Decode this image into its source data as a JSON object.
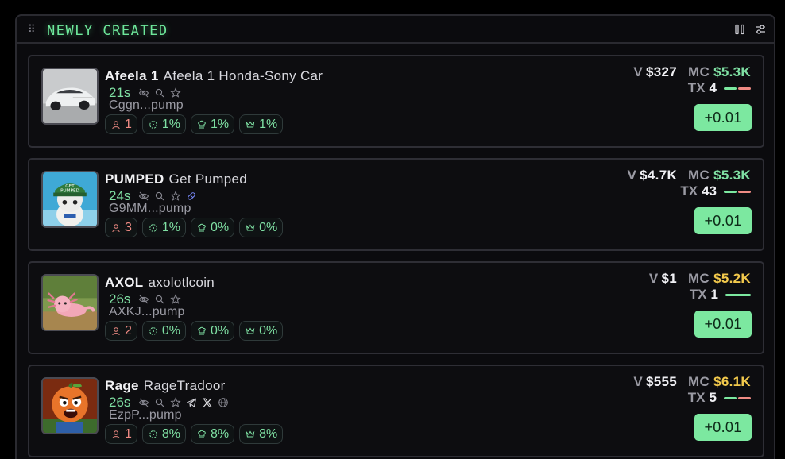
{
  "panel": {
    "title": "NEWLY CREATED",
    "icons": {
      "drag": "drag-handle-icon",
      "pause": "pause-icon",
      "filter": "filter-sliders-icon"
    }
  },
  "labels": {
    "volume": "V",
    "market_cap": "MC",
    "tx": "TX"
  },
  "colors": {
    "accent_green": "#6ee89b",
    "mc_green": "#7fe0a3",
    "mc_yellow": "#f2c94c",
    "holders_red": "#f08b84",
    "buy_button": "#7ce8a0",
    "tx_buy": "#7ce8a0",
    "tx_sell": "#f08b84"
  },
  "tokens": [
    {
      "ticker": "Afeela 1",
      "name": "Afeela 1 Honda-Sony Car",
      "age": "21s",
      "meta_icons": [
        "eye-off-icon",
        "search-icon",
        "star-icon"
      ],
      "address": "Cggn...pump",
      "holders": "1",
      "stat2": "1%",
      "stat3": "1%",
      "stat4": "1%",
      "volume": "$327",
      "market_cap": "$5.3K",
      "mc_color": "green",
      "tx": "4",
      "tx_buy_ratio": 0.5,
      "buy_label": "+0.01",
      "avatar": "car-image"
    },
    {
      "ticker": "PUMPED",
      "name": "Get Pumped",
      "age": "24s",
      "meta_icons": [
        "eye-off-icon",
        "search-icon",
        "star-icon",
        "pumpfun-icon"
      ],
      "address": "G9MM...pump",
      "holders": "3",
      "stat2": "1%",
      "stat3": "0%",
      "stat4": "0%",
      "volume": "$4.7K",
      "market_cap": "$5.3K",
      "mc_color": "green",
      "tx": "43",
      "tx_buy_ratio": 0.5,
      "buy_label": "+0.01",
      "avatar": "cartoon-pumped-image"
    },
    {
      "ticker": "AXOL",
      "name": "axolotlcoin",
      "age": "26s",
      "meta_icons": [
        "eye-off-icon",
        "search-icon",
        "star-icon"
      ],
      "address": "AXKJ...pump",
      "holders": "2",
      "stat2": "0%",
      "stat3": "0%",
      "stat4": "0%",
      "volume": "$1",
      "market_cap": "$5.2K",
      "mc_color": "yellow",
      "tx": "1",
      "tx_buy_ratio": 1.0,
      "buy_label": "+0.01",
      "avatar": "axolotl-image"
    },
    {
      "ticker": "Rage",
      "name": "RageTradoor",
      "age": "26s",
      "meta_icons": [
        "eye-off-icon",
        "search-icon",
        "star-icon",
        "telegram-icon",
        "x-icon",
        "globe-icon"
      ],
      "address": "EzpP...pump",
      "holders": "1",
      "stat2": "8%",
      "stat3": "8%",
      "stat4": "8%",
      "volume": "$555",
      "market_cap": "$6.1K",
      "mc_color": "yellow",
      "tx": "5",
      "tx_buy_ratio": 0.5,
      "buy_label": "+0.01",
      "avatar": "angry-pumpkin-image"
    }
  ]
}
